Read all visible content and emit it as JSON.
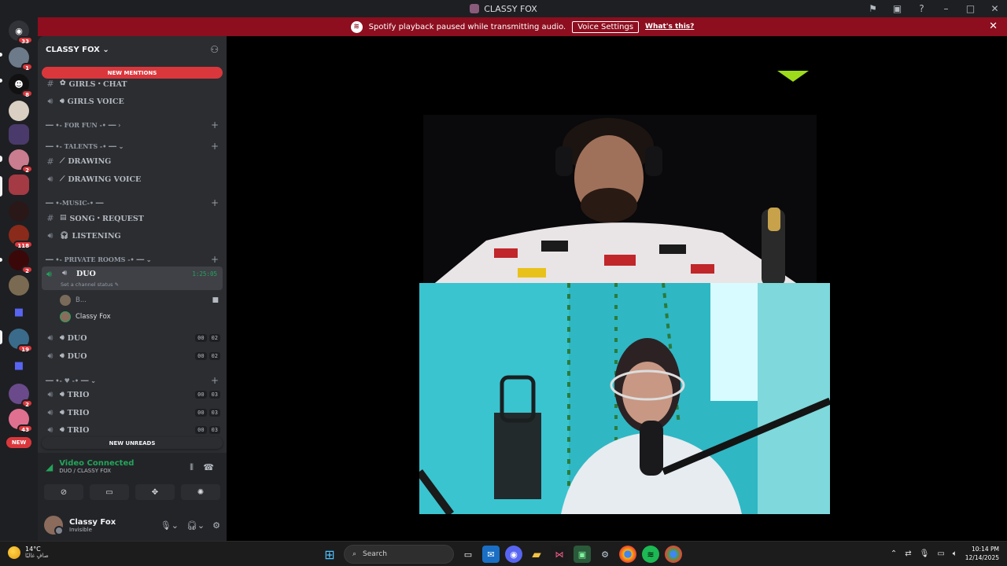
{
  "window": {
    "title": "CLASSY FOX"
  },
  "banner": {
    "message": "Spotify playback paused while transmitting audio.",
    "button": "Voice Settings",
    "link": "What's this?"
  },
  "rail": {
    "badges": [
      "33",
      "1",
      "8",
      "2",
      "118",
      "2",
      "19",
      "2",
      "43",
      "1"
    ],
    "new_label": "NEW"
  },
  "guild": {
    "name": "CLASSY FOX"
  },
  "sidebar": {
    "new_mentions": "NEW MENTIONS",
    "new_unreads": "NEW UNREADS",
    "channels": [
      {
        "type": "text",
        "name": "GIRLS・CHAT"
      },
      {
        "type": "voice",
        "name": "GIRLS VOICE"
      }
    ],
    "categories": {
      "for_fun": "━━ •- FOR FUN -• ━━",
      "talents": "━━ •- TALENTS -• ━━",
      "music": "━━ •-MUSIC-• ━━",
      "private": "━━ •- PRIVATE ROOMS -• ━━",
      "heart": "━━ •- ♥ -• ━━"
    },
    "talents": [
      {
        "name": "DRAWING"
      },
      {
        "name": "DRAWING VOICE"
      }
    ],
    "music": [
      {
        "name": "SONG・REQUEST"
      },
      {
        "name": "LISTENING"
      }
    ],
    "active": {
      "name": "DUO",
      "status": "Set a channel status",
      "time": "1:25:05",
      "users": [
        {
          "name": "B..."
        },
        {
          "name": "Classy Fox"
        }
      ]
    },
    "duos": [
      {
        "name": "DUO",
        "a": "00",
        "b": "02"
      },
      {
        "name": "DUO",
        "a": "00",
        "b": "02"
      }
    ],
    "trios": [
      {
        "name": "TRIO",
        "a": "00",
        "b": "03"
      },
      {
        "name": "TRIO",
        "a": "00",
        "b": "03"
      },
      {
        "name": "TRIO",
        "a": "00",
        "b": "03"
      }
    ]
  },
  "voice": {
    "status": "Video Connected",
    "channel": "DUO / CLASSY FOX"
  },
  "user": {
    "name": "Classy Fox",
    "status": "Invisible"
  },
  "taskbar": {
    "temp": "14°C",
    "weather": "صافٍ غالبًا",
    "search": "Search",
    "time": "10:14 PM",
    "date": "12/14/2025"
  },
  "colors": {
    "banner": "#8c0e1f",
    "mention": "#da373c",
    "connected": "#23a55a",
    "speaker_indicator": "#9ddc1b"
  }
}
